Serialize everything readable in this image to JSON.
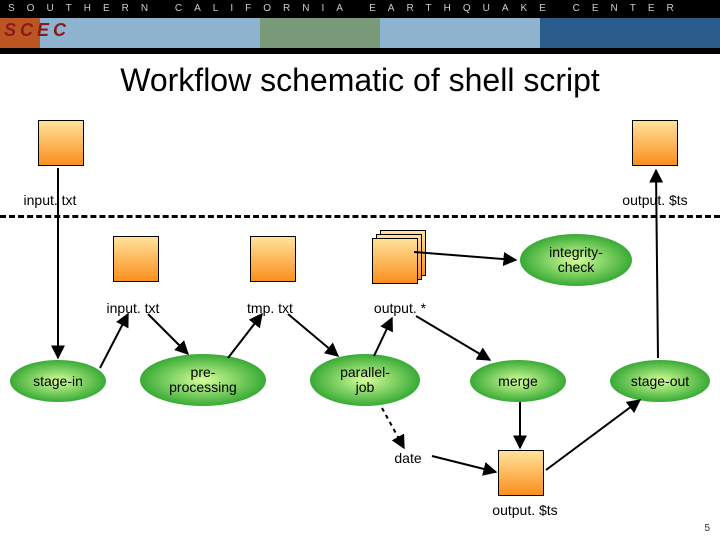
{
  "header": {
    "strip_text": "SOUTHERN  CALIFORNIA  EARTHQUAKE  CENTER",
    "logo": "SCEC"
  },
  "title": "Workflow schematic of shell script",
  "file_labels": {
    "top_left": "input. txt",
    "top_right": "output. $ts",
    "mid_input": "input. txt",
    "tmp": "tmp. txt",
    "outstar": "output. *",
    "bottom_output": "output. $ts",
    "date": "date"
  },
  "stages": {
    "integrity": "integrity-\ncheck",
    "stage_in": "stage-in",
    "preproc": "pre-\nprocessing",
    "parallel": "parallel-\njob",
    "merge": "merge",
    "stage_out": "stage-out"
  },
  "pagenum": "5"
}
